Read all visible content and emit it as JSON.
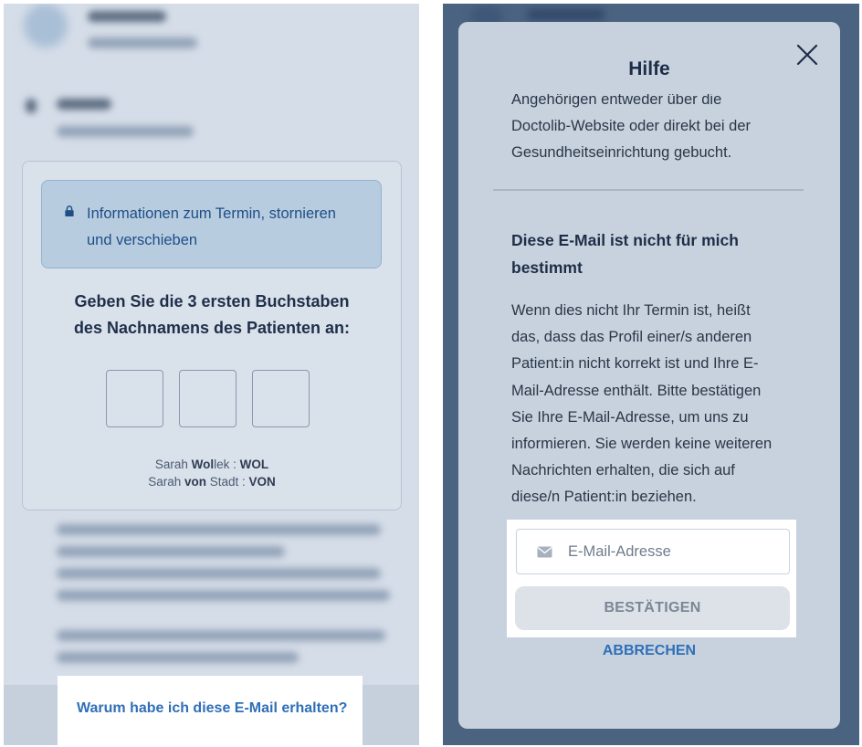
{
  "left_panel": {
    "info_box": {
      "icon": "lock-icon",
      "text_line1": "Informationen zum Termin, stornieren",
      "text_line2": "und verschieben"
    },
    "title_line1": "Geben Sie die 3 ersten Buchstaben",
    "title_line2": "des Nachnamens des Patienten an:",
    "letter_inputs": [
      "",
      "",
      ""
    ],
    "example1": {
      "prefix": "Sarah ",
      "bold": "Wol",
      "rest": "lek : ",
      "code": "WOL"
    },
    "example2": {
      "prefix": "Sarah ",
      "bold": "von",
      "rest": " Stadt : ",
      "code": "VON"
    },
    "why_link": "Warum habe ich diese E-Mail erhalten?"
  },
  "modal": {
    "title": "Hilfe",
    "close_icon": "close-icon",
    "faq_lines": [
      "Angehörigen entweder über die",
      "Doctolib-Website oder direkt bei der",
      "Gesundheitseinrichtung gebucht."
    ],
    "section_title_line1": "Diese E-Mail ist nicht für mich",
    "section_title_line2": "bestimmt",
    "section_lines": [
      "Wenn dies nicht Ihr Termin ist, heißt",
      "das, dass das Profil einer/s anderen",
      "Patient:in nicht korrekt ist und Ihre E-",
      "Mail-Adresse enthält. Bitte bestätigen",
      "Sie Ihre E-Mail-Adresse, um uns zu",
      "informieren. Sie werden keine weiteren",
      "Nachrichten erhalten, die sich auf",
      "diese/n Patient:in beziehen."
    ],
    "email_placeholder": "E-Mail-Adresse",
    "email_icon": "envelope-icon",
    "confirm_label": "BESTÄTIGEN",
    "cancel_label": "ABBRECHEN"
  },
  "colors": {
    "accent_link": "#2f6fb8",
    "info_text": "#1f4e86",
    "overlay": "#4a6380"
  }
}
